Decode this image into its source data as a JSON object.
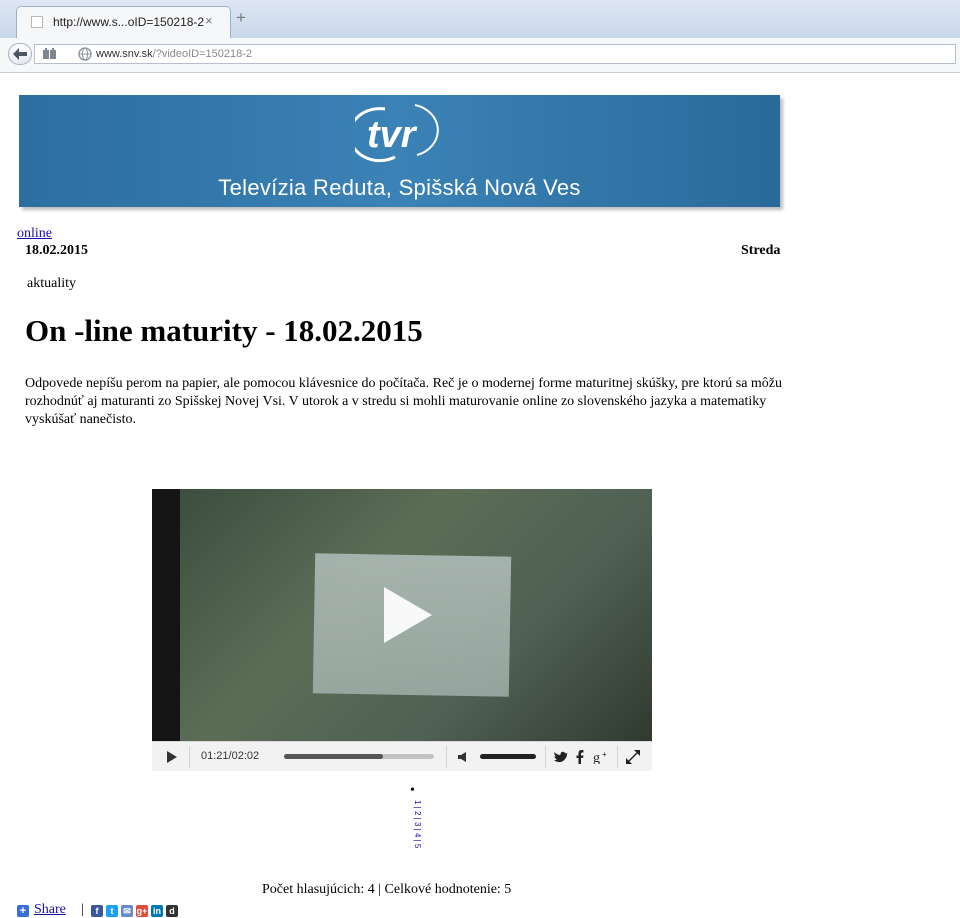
{
  "browser": {
    "tab_title": "http://www.s...oID=150218-2",
    "tab_close": "×",
    "new_tab": "+",
    "url_host": "www.snv.sk",
    "url_path": "/?videoID=150218-2"
  },
  "banner": {
    "logo_text": "tvr",
    "title": "Televízia Reduta, Spišská Nová Ves"
  },
  "article": {
    "online_link": "online",
    "date": "18.02.2015",
    "weekday": "Streda",
    "category": "aktuality",
    "headline": "On -line maturity - 18.02.2015",
    "lead": "Odpovede nepíšu perom na papier, ale pomocou klávesnice do počítača. Reč je o modernej forme maturitnej skúšky, pre ktorú sa môžu rozhodnúť aj maturanti zo Spišskej Novej Vsi. V utorok a v stredu si mohli maturovanie online zo slovenského jazyka a matematiky vyskúšať nanečisto."
  },
  "player": {
    "timecode": "01:21/02:02",
    "progress": 0.66,
    "volume": 1.0,
    "social_icons": [
      "twitter-icon",
      "facebook-icon",
      "google-plus-icon"
    ],
    "fullscreen_icon": "fullscreen-icon"
  },
  "rating": {
    "bullet": "•",
    "scale_text": "1 | 2 | 3 | 4 | 5",
    "votes": "Počet hlasujúcich: 4 | Celkové hodnotenie: 5"
  },
  "share": {
    "plus": "+",
    "label": "Share",
    "separator": "|",
    "icons": [
      {
        "name": "facebook-icon",
        "glyph": "f",
        "color": "#3b5998"
      },
      {
        "name": "twitter-icon",
        "glyph": "t",
        "color": "#1da1f2"
      },
      {
        "name": "email-icon",
        "glyph": "✉",
        "color": "#6b8ac9"
      },
      {
        "name": "google-plus-icon",
        "glyph": "g+",
        "color": "#dd4b39"
      },
      {
        "name": "linkedin-icon",
        "glyph": "in",
        "color": "#0077b5"
      },
      {
        "name": "digg-icon",
        "glyph": "d",
        "color": "#333333"
      }
    ]
  },
  "colors": {
    "banner_blue": "#3b82b6",
    "link_blue": "#1a0dab"
  }
}
